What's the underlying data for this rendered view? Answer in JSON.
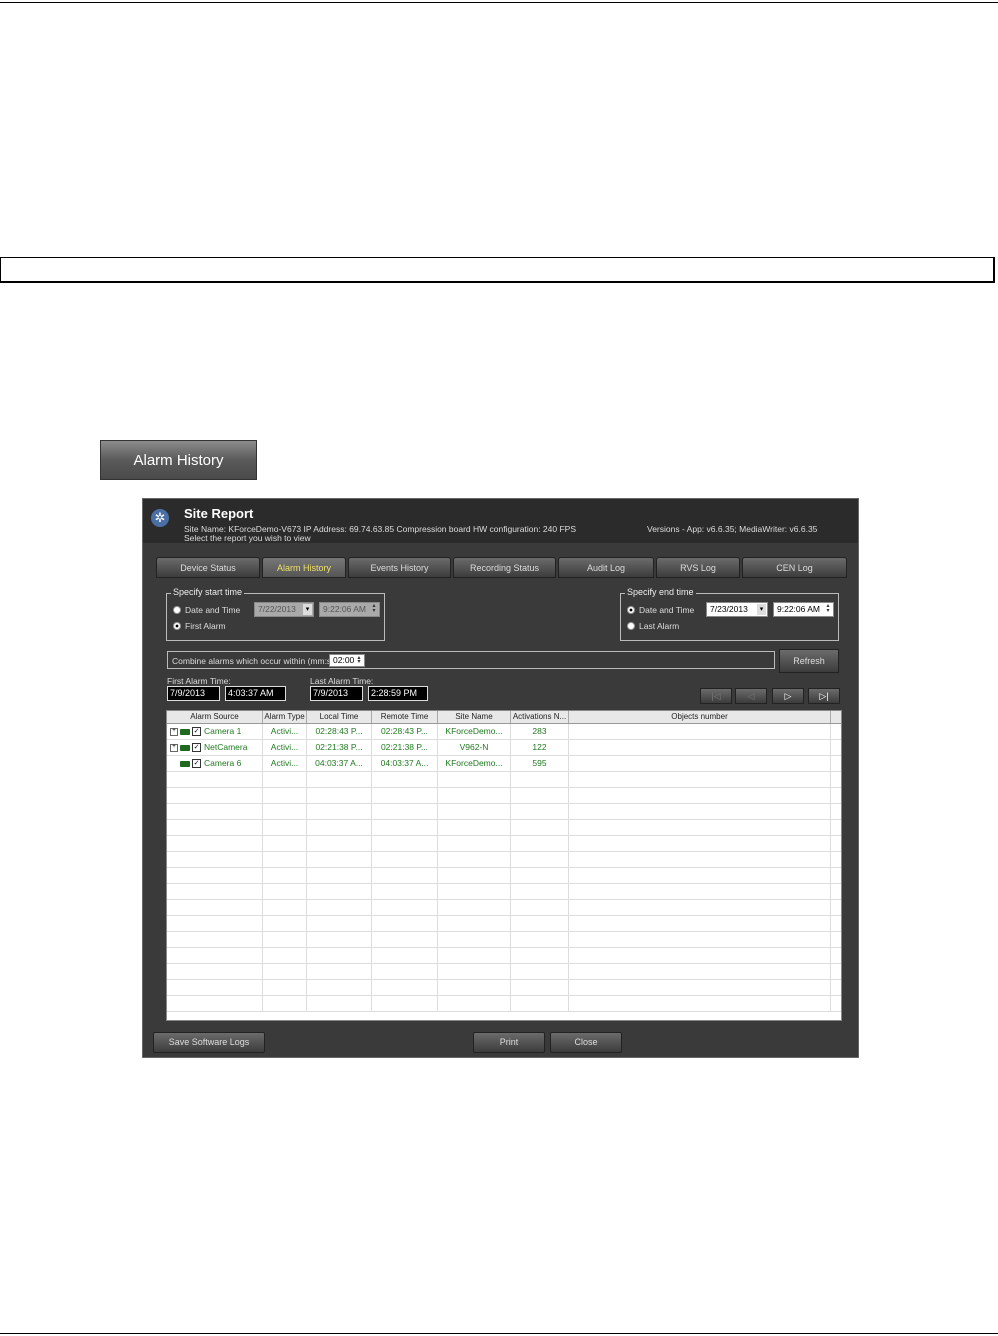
{
  "button_image": {
    "label": "Alarm History"
  },
  "window": {
    "title": "Site Report",
    "info_line": "Site Name: KForceDemo-V673   IP Address: 69.74.63.85   Compression board HW configuration: 240 FPS",
    "versions": "Versions - App: v6.6.35; MediaWriter: v6.6.35",
    "instruction": "Select the report you wish to view"
  },
  "tabs": [
    {
      "label": "Device Status"
    },
    {
      "label": "Alarm History"
    },
    {
      "label": "Events History"
    },
    {
      "label": "Recording Status"
    },
    {
      "label": "Audit Log"
    },
    {
      "label": "RVS Log"
    },
    {
      "label": "CEN Log"
    }
  ],
  "start": {
    "title": "Specify start time",
    "opt_date": "Date and Time",
    "opt_first": "First Alarm",
    "date": "7/22/2013",
    "time": "9:22:06 AM"
  },
  "end": {
    "title": "Specify end time",
    "opt_date": "Date and Time",
    "opt_last": "Last Alarm",
    "date": "7/23/2013",
    "time": "9:22:06 AM"
  },
  "combine": {
    "label": "Combine alarms which occur within (mm:ss)",
    "value": "02:00"
  },
  "refresh_label": "Refresh",
  "first_alarm": {
    "label": "First Alarm Time:",
    "date": "7/9/2013",
    "time": "4:03:37 AM"
  },
  "last_alarm": {
    "label": "Last Alarm Time:",
    "date": "7/9/2013",
    "time": "2:28:59 PM"
  },
  "nav": {
    "first": "|◁",
    "prev": "◁",
    "next": "▷",
    "last": "▷|"
  },
  "table": {
    "columns": [
      "Alarm Source",
      "Alarm Type",
      "Local Time",
      "Remote Time",
      "Site Name",
      "Activations N...",
      "Objects number"
    ],
    "rows": [
      {
        "source": "Camera 1",
        "type": "Activi...",
        "local": "02:28:43 P...",
        "remote": "02:28:43 P...",
        "site": "KForceDemo...",
        "activations": "283",
        "objects": ""
      },
      {
        "source": "NetCamera",
        "type": "Activi...",
        "local": "02:21:38 P...",
        "remote": "02:21:38 P...",
        "site": "V962-N",
        "activations": "122",
        "objects": ""
      },
      {
        "source": "Camera  6",
        "type": "Activi...",
        "local": "04:03:37 A...",
        "remote": "04:03:37 A...",
        "site": "KForceDemo...",
        "activations": "595",
        "objects": ""
      }
    ]
  },
  "buttons": {
    "save_logs": "Save Software Logs",
    "print": "Print",
    "close": "Close"
  }
}
